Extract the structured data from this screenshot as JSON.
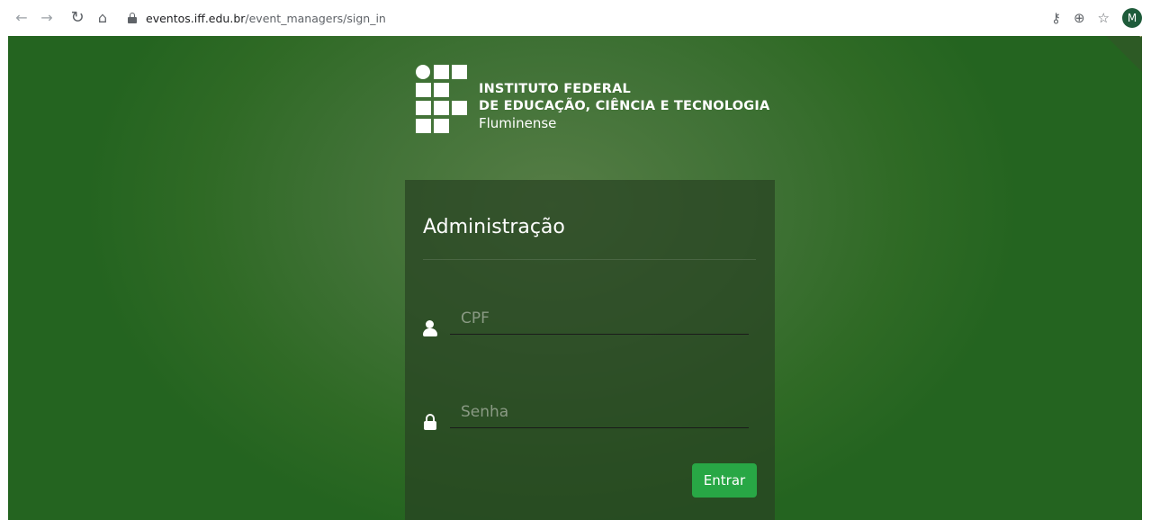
{
  "browser": {
    "url_host": "eventos.iff.edu.br",
    "url_path": "/event_managers/sign_in",
    "avatar_initial": "M",
    "icons": [
      "back-arrow-icon",
      "forward-arrow-icon",
      "reload-icon",
      "home-icon",
      "lock-icon",
      "key-icon",
      "zoom-icon",
      "star-icon"
    ]
  },
  "logo": {
    "line1": "INSTITUTO FEDERAL",
    "line2": "DE EDUCAÇÃO, CIÊNCIA E TECNOLOGIA",
    "line3": "Fluminense"
  },
  "login": {
    "title": "Administração",
    "cpf_placeholder": "CPF",
    "cpf_value": "",
    "password_placeholder": "Senha",
    "password_value": "",
    "submit_label": "Entrar"
  },
  "colors": {
    "background_green": "#3f7135",
    "panel": "#284222",
    "button": "#28a745"
  }
}
